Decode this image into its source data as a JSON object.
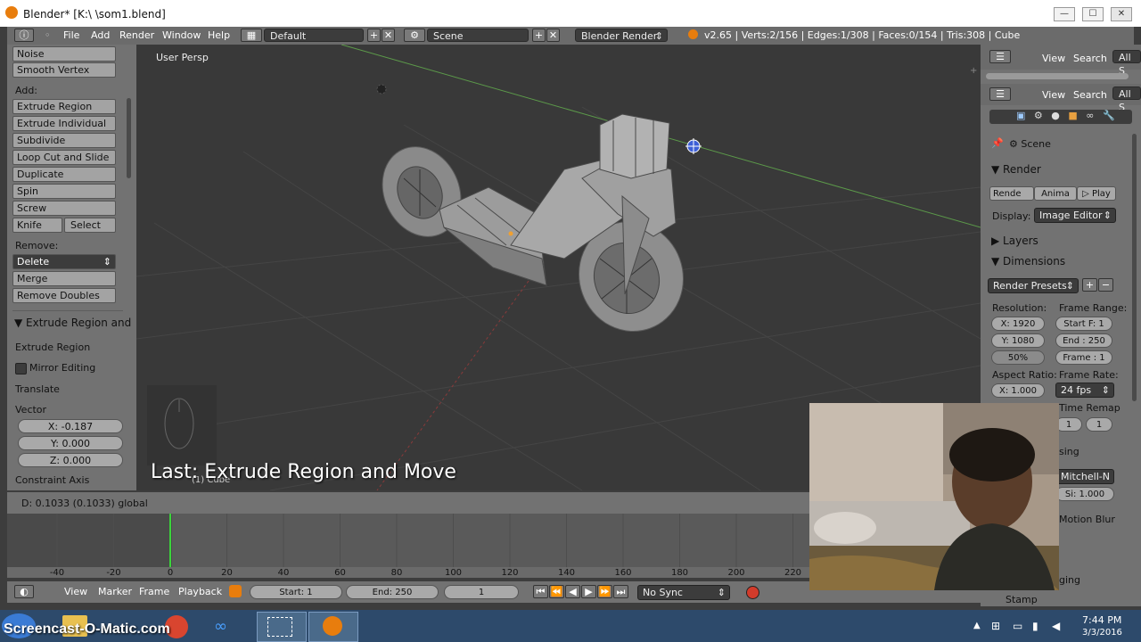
{
  "window": {
    "title": "Blender* [K:\\ \\som1.blend]",
    "min": "—",
    "max": "☐",
    "close": "✕"
  },
  "infobar": {
    "menus": [
      "File",
      "Add",
      "Render",
      "Window",
      "Help"
    ],
    "layout": "Default",
    "scene": "Scene",
    "engine": "Blender Render",
    "stats": "v2.65 | Verts:2/156 | Edges:1/308 | Faces:0/154 | Tris:308 | Cube"
  },
  "toolshelf": {
    "noise": "Noise",
    "smooth_vertex": "Smooth Vertex",
    "add_label": "Add:",
    "extrude_region": "Extrude Region",
    "extrude_individual": "Extrude Individual",
    "subdivide": "Subdivide",
    "loop_cut": "Loop Cut and Slide",
    "duplicate": "Duplicate",
    "spin": "Spin",
    "screw": "Screw",
    "knife": "Knife",
    "select": "Select",
    "remove_label": "Remove:",
    "delete": "Delete",
    "merge": "Merge",
    "remove_doubles": "Remove Doubles",
    "op_panel_title": "Extrude Region and",
    "op_name": "Extrude Region",
    "mirror_editing": "Mirror Editing",
    "translate": "Translate",
    "vector": "Vector",
    "vx": "X: -0.187",
    "vy": "Y: 0.000",
    "vz": "Z: 0.000",
    "constraint_axis": "Constraint Axis"
  },
  "viewport": {
    "view_label": "User Persp",
    "object_label": "(1) Cube",
    "last_op": "Last: Extrude Region and Move"
  },
  "status": {
    "text": "D: 0.1033 (0.1033) global"
  },
  "timeline": {
    "ticks": [
      "-40",
      "-20",
      "0",
      "20",
      "40",
      "60",
      "80",
      "100",
      "120",
      "140",
      "160",
      "180",
      "200",
      "220"
    ],
    "current_frame_value": 0
  },
  "timeline_header": {
    "menus": [
      "View",
      "Marker",
      "Frame",
      "Playback"
    ],
    "start": "Start: 1",
    "end": "End: 250",
    "current": "1",
    "sync": "No Sync"
  },
  "properties": {
    "view": "View",
    "search": "Search",
    "all": "All S",
    "scene": "Scene",
    "render_section": "Render",
    "render_btn": "Rende",
    "anim_btn": "Anima",
    "play_btn": "Play",
    "display_label": "Display:",
    "display_value": "Image Editor",
    "layers_section": "Layers",
    "dimensions_section": "Dimensions",
    "render_presets": "Render Presets",
    "resolution_label": "Resolution:",
    "res_x": "X: 1920",
    "res_y": "Y: 1080",
    "res_pct": "50%",
    "frame_range_label": "Frame Range:",
    "start_f": "Start F: 1",
    "end_f": "End : 250",
    "frame_f": "Frame : 1",
    "aspect_label": "Aspect Ratio:",
    "aspect_x": "X: 1.000",
    "frame_rate_label": "Frame Rate:",
    "fps": "24 fps",
    "time_remap": "Time Remap",
    "remap_a": "1",
    "remap_b": "1",
    "sing": "sing",
    "filter": "Mitchell-N",
    "filter_size": "Si: 1.000",
    "motion_blur": "Motion Blur",
    "ging": "ging",
    "stamp": "Stamp"
  },
  "taskbar": {
    "watermark": "Screencast-O-Matic.com",
    "time": "7:44 PM",
    "date": "3/3/2016"
  },
  "colors": {
    "accent": "#e87d0d",
    "selected_field": "#5680c2",
    "frame_line": "#3bd43b"
  }
}
